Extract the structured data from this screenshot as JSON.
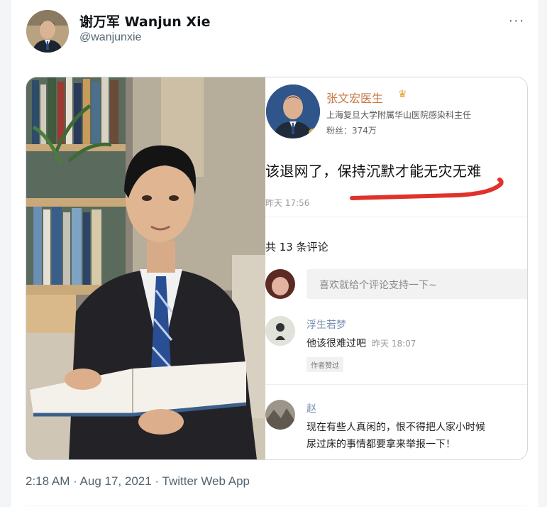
{
  "tweet": {
    "display_name": "谢万军 Wanjun Xie",
    "handle": "@wanjunxie",
    "more_label": "···",
    "timestamp_time": "2:18 AM",
    "timestamp_date": "Aug 17, 2021",
    "source": "Twitter Web App",
    "separator": " · "
  },
  "screenshot": {
    "author_name": "张文宏医生",
    "author_title": "上海复旦大学附属华山医院感染科主任",
    "author_fans": "粉丝：374万",
    "post_text": "该退网了，保持沉默才能无灾无难",
    "post_time": "昨天 17:56",
    "comment_count": "共 13 条评论",
    "comment_prompt": "喜欢就给个评论支持一下~",
    "comments": [
      {
        "name": "浮生若梦",
        "text": "他该很难过吧",
        "time": "昨天 18:07",
        "badge": "作者赞过"
      },
      {
        "name": "赵",
        "text_line1": "现在有些人真闲的，恨不得把人家小时候",
        "text_line2": "尿过床的事情都要拿来举报一下！"
      }
    ]
  },
  "colors": {
    "name_color": "#0f1419",
    "secondary_text": "#536471",
    "underline_red": "#e0322b"
  }
}
